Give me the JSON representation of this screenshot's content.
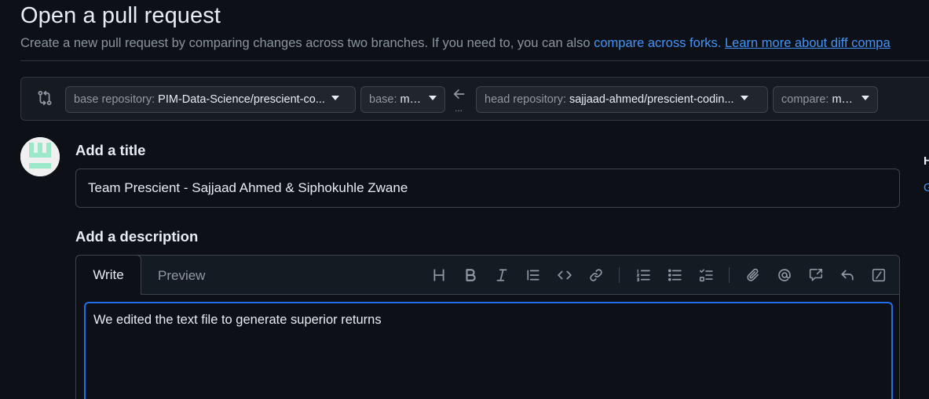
{
  "header": {
    "title": "Open a pull request",
    "subtitle_text": "Create a new pull request by comparing changes across two branches. If you need to, you can also ",
    "compare_forks_link": "compare across forks.",
    "learn_more_link": "Learn more about diff compa"
  },
  "compare": {
    "base_repo_label": "base repository:",
    "base_repo_value": "PIM-Data-Science/prescient-co...",
    "base_label": "base:",
    "base_value": "main",
    "dots": "...",
    "head_repo_label": "head repository:",
    "head_repo_value": "sajjaad-ahmed/prescient-codin...",
    "compare_label": "compare:",
    "compare_value": "main"
  },
  "form": {
    "title_label": "Add a title",
    "title_value": "Team Prescient - Sajjaad Ahmed & Siphokuhle Zwane",
    "description_label": "Add a description",
    "write_tab": "Write",
    "preview_tab": "Preview",
    "description_value": "We edited the text file to generate superior returns"
  },
  "toolbar_icons": [
    "heading-icon",
    "bold-icon",
    "italic-icon",
    "quote-icon",
    "code-icon",
    "link-icon",
    "ordered-list-icon",
    "unordered-list-icon",
    "task-list-icon",
    "attach-icon",
    "mention-icon",
    "reference-icon",
    "undo-icon",
    "slash-commands-icon"
  ],
  "sidebar": {
    "h_text": "H",
    "g_text": "G"
  },
  "colors": {
    "background": "#0d1117",
    "link": "#4493f8",
    "focus_border": "#1f6feb",
    "avatar_green": "#9be9c8"
  }
}
